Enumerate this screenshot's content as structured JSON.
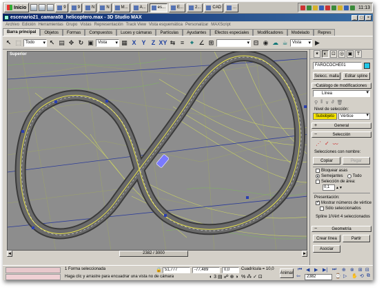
{
  "taskbar": {
    "start": "Inicio",
    "tasks": [
      {
        "label": "9"
      },
      {
        "label": "9"
      },
      {
        "label": "N"
      },
      {
        "label": "N"
      },
      {
        "label": "M..."
      },
      {
        "label": "A..."
      },
      {
        "label": "es..."
      },
      {
        "label": "E..."
      },
      {
        "label": "2..."
      },
      {
        "label": "CAD"
      },
      {
        "label": "..."
      }
    ],
    "clock": "11:13"
  },
  "window": {
    "title": "escenario21_camara08_helicoptero.max - 3D Studio MAX"
  },
  "menu": [
    "Archivo",
    "Edición",
    "Herramientas",
    "Grupo",
    "Vistas",
    "Representación",
    "Track View",
    "Vista esquemática",
    "Personalizar",
    "MAXScript"
  ],
  "tabs": [
    "Barra principal",
    "Objetos",
    "Formas",
    "Compuestos",
    "Luces y cámaras",
    "Partículas",
    "Ayudantes",
    "Efectos especiales",
    "Modificadores",
    "Modelado",
    "Repres"
  ],
  "toolbar": {
    "filter": "Todo",
    "coord": "Vista",
    "axes": [
      "X",
      "Y",
      "Z",
      "XY"
    ],
    "named_sel": "",
    "viewport_sel": "Vista"
  },
  "viewport": {
    "label": "Superior",
    "counter": "2382 / 3000"
  },
  "panel": {
    "object_name": "FAROCOCHE01",
    "color": "#20c8e8",
    "btn_select_mesh": "Selecc. malla",
    "btn_edit_spline": "Editar spline",
    "mod_catalog": "Catálogo de modificaciones",
    "stack_item": "Línea",
    "level_label": "Nivel de selección:",
    "sub_btn": "Subobjeto",
    "sub_level": "Vértice",
    "rollout_general": "General",
    "rollout_seleccion": "Selección",
    "named_sel_label": "Selecciones con nombre:",
    "btn_copy": "Copiar",
    "btn_paste": "Pegar",
    "lock_handles": "Bloquear asas",
    "radio_similar": "Semejantes",
    "radio_all": "Todo",
    "area_sel": "Selección de área:",
    "area_value": "0,1",
    "display_label": "Presentación:",
    "show_vertex_numbers": "Mostrar números de vértice",
    "only_selected": "Sólo seleccionados",
    "sel_info": "Spline 1/Vért 4 seleccionados",
    "rollout_geometry": "Geometría",
    "btn_create_line": "Crear línea",
    "btn_break": "Partir",
    "btn_attach": "Asociar"
  },
  "status": {
    "selected": "1 Forma seleccionada",
    "prompt": "Haga clic y arrastre para encuadrar una vista no de cámara",
    "x": "51,777",
    "y": "-77,489",
    "z": "0,0",
    "grid": "Cuadrícula = 10,0",
    "animate": "Animar",
    "frame": "2382"
  }
}
